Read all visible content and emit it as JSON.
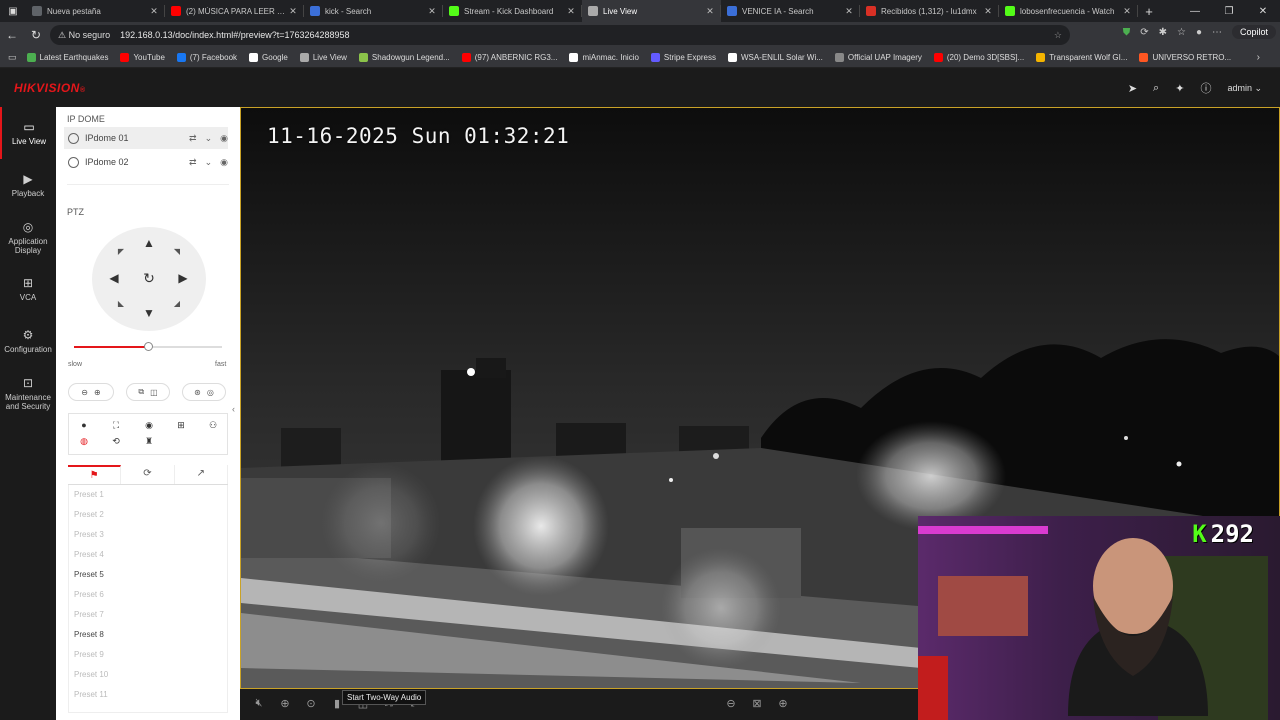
{
  "browser": {
    "tabs": [
      {
        "label": "Nueva pestaña",
        "color": "#5f6368",
        "active": false
      },
      {
        "label": "(2) MÚSICA PARA LEER TER",
        "color": "#ff0000",
        "active": false
      },
      {
        "label": "kick - Search",
        "color": "#3b6fd8",
        "active": false
      },
      {
        "label": "Stream - Kick Dashboard",
        "color": "#53fc18",
        "active": false
      },
      {
        "label": "Live View",
        "color": "#aaaaaa",
        "active": true
      },
      {
        "label": "VENICE IA - Search",
        "color": "#3b6fd8",
        "active": false
      },
      {
        "label": "Recibidos (1,312) - lu1dmx",
        "color": "#d93025",
        "active": false
      },
      {
        "label": "lobosenfrecuencia - Watch",
        "color": "#53fc18",
        "active": false
      }
    ],
    "new_tab": "+",
    "window_buttons": [
      "—",
      "❐",
      "✕"
    ],
    "address": {
      "security_label": "No seguro",
      "url": "192.168.0.13/doc/index.html#/preview?t=1763264288958"
    },
    "copilot_label": "Copilot",
    "bookmarks": [
      {
        "label": "Latest Earthquakes",
        "color": "#4caf50"
      },
      {
        "label": "YouTube",
        "color": "#ff0000"
      },
      {
        "label": "(7) Facebook",
        "color": "#1877f2"
      },
      {
        "label": "Google",
        "color": "#ffffff"
      },
      {
        "label": "Live View",
        "color": "#aaaaaa"
      },
      {
        "label": "Shadowgun Legend...",
        "color": "#8bc34a"
      },
      {
        "label": "(97) ANBERNIC RG3...",
        "color": "#ff0000"
      },
      {
        "label": "miAnmac. Inicio",
        "color": "#ffffff"
      },
      {
        "label": "Stripe Express",
        "color": "#635bff"
      },
      {
        "label": "WSA-ENLIL Solar Wi...",
        "color": "#ffffff"
      },
      {
        "label": "Official UAP Imagery",
        "color": "#888888"
      },
      {
        "label": "(20) Demo 3D[SBS]...",
        "color": "#ff0000"
      },
      {
        "label": "Transparent Wolf GI...",
        "color": "#f4b400"
      },
      {
        "label": "UNIVERSO RETRO...",
        "color": "#ff5722"
      }
    ]
  },
  "app": {
    "logo": "HIKVISION",
    "logo_mark": "®",
    "user": "admin",
    "nav": [
      {
        "label": "Live View",
        "icon": "▭",
        "active": true
      },
      {
        "label": "Playback",
        "icon": "▶",
        "active": false
      },
      {
        "label": "Application Display",
        "icon": "◎",
        "active": false
      },
      {
        "label": "VCA",
        "icon": "⊞",
        "active": false
      },
      {
        "label": "Configuration",
        "icon": "⚙",
        "active": false
      },
      {
        "label": "Maintenance and Security",
        "icon": "⊡",
        "active": false
      }
    ]
  },
  "panel": {
    "section_cameras": "IP DOME",
    "cameras": [
      {
        "name": "IPdome 01",
        "selected": true
      },
      {
        "name": "IPdome 02",
        "selected": false
      }
    ],
    "section_ptz": "PTZ",
    "speed": {
      "value": 0.5,
      "slow_label": "slow",
      "fast_label": "fast"
    },
    "preset_tabs": [
      "⚑",
      "⟳",
      "↗"
    ],
    "presets": [
      {
        "label": "Preset 1",
        "enabled": false
      },
      {
        "label": "Preset 2",
        "enabled": false
      },
      {
        "label": "Preset 3",
        "enabled": false
      },
      {
        "label": "Preset 4",
        "enabled": false
      },
      {
        "label": "Preset 5",
        "enabled": true
      },
      {
        "label": "Preset 6",
        "enabled": false
      },
      {
        "label": "Preset 7",
        "enabled": false
      },
      {
        "label": "Preset 8",
        "enabled": true
      },
      {
        "label": "Preset 9",
        "enabled": false
      },
      {
        "label": "Preset 10",
        "enabled": false
      },
      {
        "label": "Preset 11",
        "enabled": false
      }
    ]
  },
  "video": {
    "osd_timestamp": "11-16-2025 Sun 01:32:21",
    "tooltip": "Start Two-Way Audio"
  },
  "overlay": {
    "kick_logo": "K",
    "viewer_count": "292"
  }
}
